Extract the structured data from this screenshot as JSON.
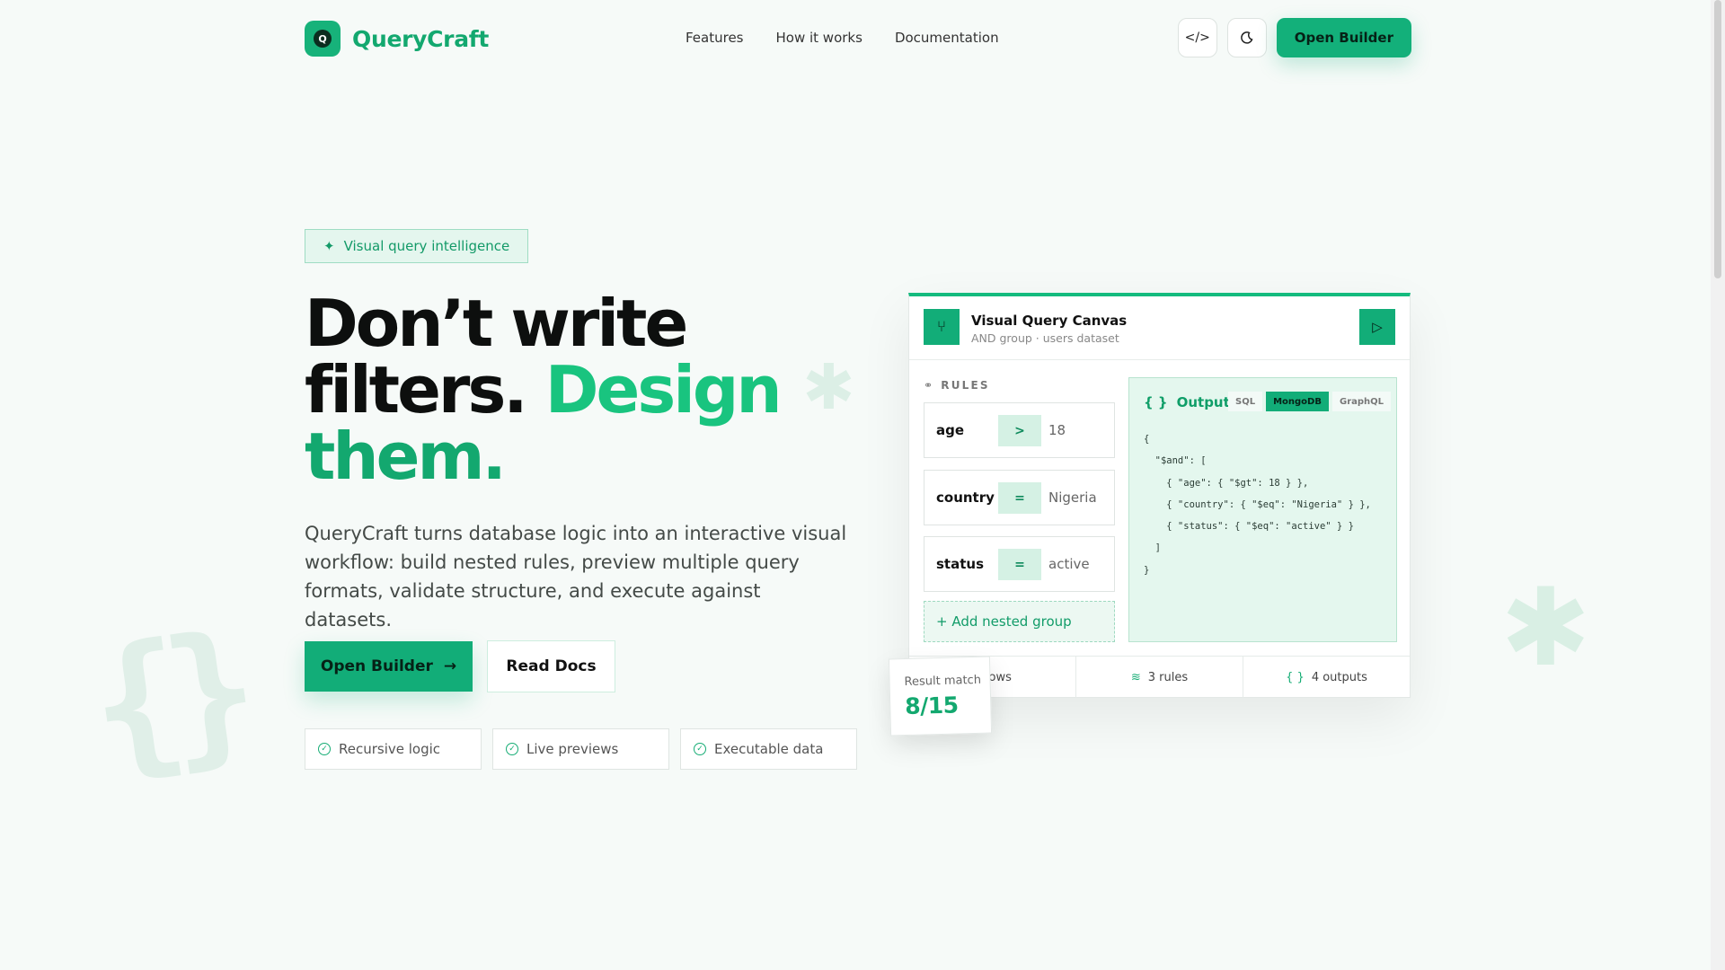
{
  "nav": {
    "brand": "QueryCraft",
    "brand_mark": "Q",
    "links": [
      "Features",
      "How it works",
      "Documentation"
    ],
    "code_icon": "code-icon",
    "theme_icon": "moon-icon",
    "open_builder": "Open Builder"
  },
  "hero": {
    "badge": "Visual query intelligence",
    "headline_1": "Don’t write",
    "headline_2": "filters.",
    "headline_3": "Design",
    "headline_4": "them.",
    "lead": "QueryCraft turns database logic into an interactive visual workflow: build nested rules, preview multiple query formats, validate structure, and execute against datasets.",
    "cta_primary": "Open Builder",
    "cta_secondary": "Read Docs",
    "chips": [
      "Recursive logic",
      "Live previews",
      "Executable data"
    ]
  },
  "canvas": {
    "title": "Visual Query Canvas",
    "subtitle": "AND group · users dataset",
    "rules_label": "RULES",
    "rules": [
      {
        "field": "age",
        "op": ">",
        "value": "18"
      },
      {
        "field": "country",
        "op": "=",
        "value": "Nigeria"
      },
      {
        "field": "status",
        "op": "=",
        "value": "active"
      }
    ],
    "add_group": "+ Add nested group",
    "output_label": "Output",
    "output_tabs": [
      "SQL",
      "MongoDB",
      "GraphQL"
    ],
    "active_tab": "MongoDB",
    "code": "{\n  \"$and\": [\n    { \"age\": { \"$gt\": 18 } },\n    { \"country\": { \"$eq\": \"Nigeria\" } },\n    { \"status\": { \"$eq\": \"active\" } }\n  ]\n}",
    "stats": [
      "5 rows",
      "3 rules",
      "4 outputs"
    ],
    "result_label": "Result match",
    "result_value": "8/15"
  },
  "colors": {
    "accent": "#13b07a",
    "accent_dark": "#0f9e68",
    "accent_light": "#e4f7ee"
  }
}
